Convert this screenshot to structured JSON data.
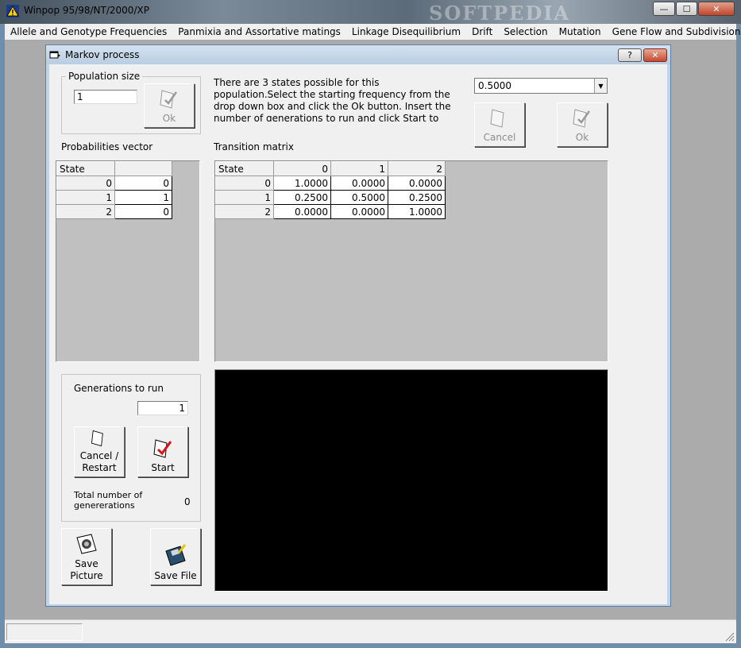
{
  "app": {
    "title": "Winpop 95/98/NT/2000/XP",
    "watermark": "SOFTPEDIA",
    "controls": {
      "minimize": "—",
      "maximize": "☐",
      "close": "✕"
    }
  },
  "menubar": {
    "items": [
      "Allele and Genotype Frequencies",
      "Panmixia and Assortative matings",
      "Linkage Disequilibrium",
      "Drift",
      "Selection",
      "Mutation",
      "Gene Flow and Subdivision"
    ]
  },
  "dialog": {
    "title": "Markov process",
    "help": "?",
    "close": "✕",
    "population": {
      "label": "Population size",
      "value": "1",
      "ok_label": "Ok"
    },
    "instructions": "There are 3 states possible for this population.Select the starting frequency from the drop down box and click the Ok button. Insert the number of generations to run and click Start to generate the graph.",
    "frequency": {
      "selected": "0.5000"
    },
    "cancel_label": "Cancel",
    "ok_label": "Ok",
    "probabilities": {
      "label": "Probabilities vector",
      "header": [
        "State",
        ""
      ],
      "rows": [
        [
          "0",
          "0"
        ],
        [
          "1",
          "1"
        ],
        [
          "2",
          "0"
        ]
      ]
    },
    "transition": {
      "label": "Transition matrix",
      "header": [
        "State",
        "0",
        "1",
        "2"
      ],
      "rows": [
        [
          "0",
          "1.0000",
          "0.0000",
          "0.0000"
        ],
        [
          "1",
          "0.2500",
          "0.5000",
          "0.2500"
        ],
        [
          "2",
          "0.0000",
          "0.0000",
          "1.0000"
        ]
      ]
    },
    "generations": {
      "label": "Generations to run",
      "value": "1",
      "cancel_restart_label": "Cancel / Restart",
      "start_label": "Start",
      "total_label": "Total number of genererations run:",
      "total_value": "0"
    },
    "save_picture_label": "Save Picture",
    "save_file_label": "Save File"
  },
  "colors": {
    "graph_background": "#000000",
    "grid_background": "#c0c0c0",
    "dialog_background": "#f0f0f0"
  }
}
